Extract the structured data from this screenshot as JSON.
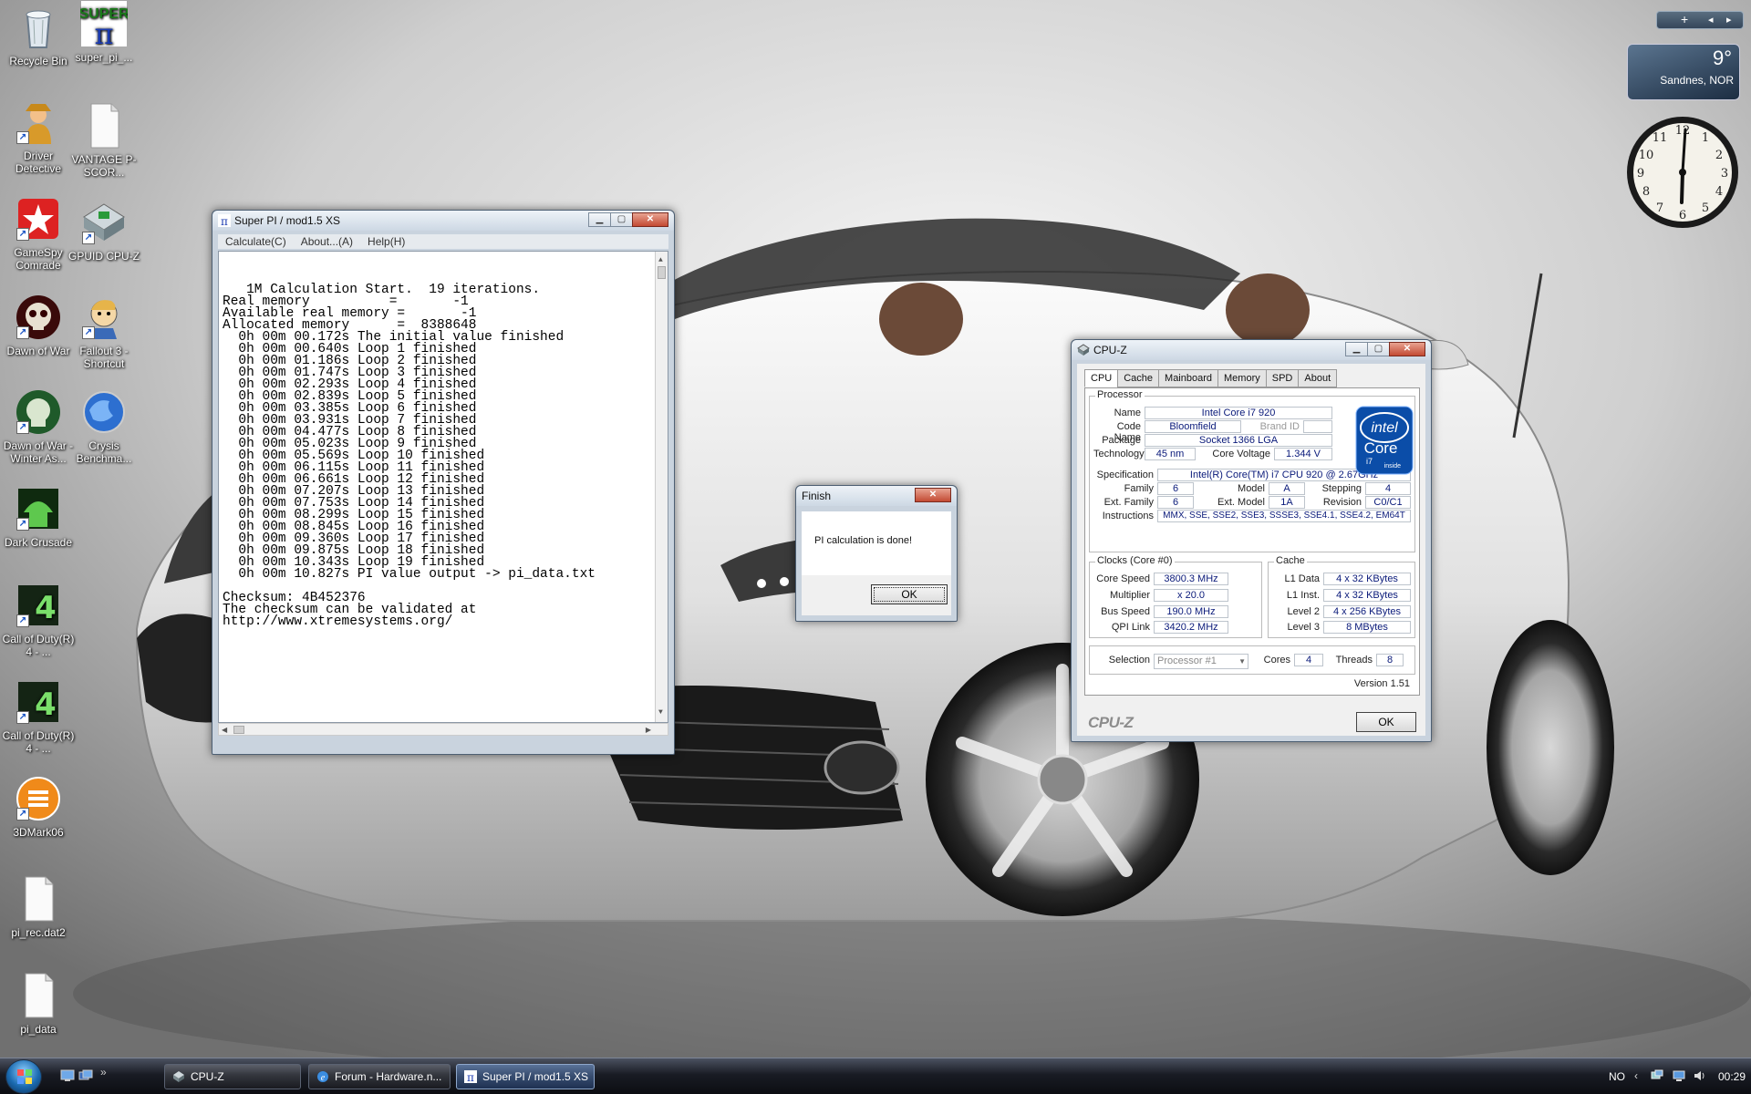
{
  "desktop": {
    "icons": [
      {
        "label": "Recycle Bin"
      },
      {
        "label": "super_pi_..."
      },
      {
        "label": "Driver Detective"
      },
      {
        "label": "VANTAGE P-SCOR..."
      },
      {
        "label": "GameSpy Comrade"
      },
      {
        "label": "GPUID CPU-Z"
      },
      {
        "label": "Dawn of War"
      },
      {
        "label": "Fallout 3 - Shortcut"
      },
      {
        "label": "Dawn of War - Winter As..."
      },
      {
        "label": "Crysis Benchma..."
      },
      {
        "label": "Dark Crusade"
      },
      {
        "label": "Call of Duty(R) 4 - ..."
      },
      {
        "label": "Call of Duty(R) 4 - ..."
      },
      {
        "label": "3DMark06"
      },
      {
        "label": "pi_rec.dat2"
      },
      {
        "label": "pi_data"
      }
    ]
  },
  "gadgets": {
    "weather": {
      "temp": "9°",
      "city": "Sandnes, NOR"
    },
    "toolbar": {
      "add": "+",
      "prev": "◂",
      "next": "▸"
    }
  },
  "superpi": {
    "title": "Super PI / mod1.5 XS",
    "menu": [
      "Calculate(C)",
      "About...(A)",
      "Help(H)"
    ],
    "output": [
      "   1M Calculation Start.  19 iterations.",
      "Real memory          =       -1",
      "Available real memory =       -1",
      "Allocated memory      =  8388648",
      "  0h 00m 00.172s The initial value finished",
      "  0h 00m 00.640s Loop 1 finished",
      "  0h 00m 01.186s Loop 2 finished",
      "  0h 00m 01.747s Loop 3 finished",
      "  0h 00m 02.293s Loop 4 finished",
      "  0h 00m 02.839s Loop 5 finished",
      "  0h 00m 03.385s Loop 6 finished",
      "  0h 00m 03.931s Loop 7 finished",
      "  0h 00m 04.477s Loop 8 finished",
      "  0h 00m 05.023s Loop 9 finished",
      "  0h 00m 05.569s Loop 10 finished",
      "  0h 00m 06.115s Loop 11 finished",
      "  0h 00m 06.661s Loop 12 finished",
      "  0h 00m 07.207s Loop 13 finished",
      "  0h 00m 07.753s Loop 14 finished",
      "  0h 00m 08.299s Loop 15 finished",
      "  0h 00m 08.845s Loop 16 finished",
      "  0h 00m 09.360s Loop 17 finished",
      "  0h 00m 09.875s Loop 18 finished",
      "  0h 00m 10.343s Loop 19 finished",
      "  0h 00m 10.827s PI value output -> pi_data.txt",
      "",
      "Checksum: 4B452376",
      "The checksum can be validated at",
      "http://www.xtremesystems.org/"
    ]
  },
  "finish": {
    "title": "Finish",
    "message": "PI calculation is done!",
    "ok": "OK"
  },
  "cpuz": {
    "title": "CPU-Z",
    "tabs": [
      "CPU",
      "Cache",
      "Mainboard",
      "Memory",
      "SPD",
      "About"
    ],
    "processor": {
      "legend": "Processor",
      "name_label": "Name",
      "name": "Intel Core i7 920",
      "codename_label": "Code Name",
      "codename": "Bloomfield",
      "brandid_label": "Brand ID",
      "brandid": "",
      "package_label": "Package",
      "package": "Socket 1366 LGA",
      "technology_label": "Technology",
      "technology": "45 nm",
      "voltage_label": "Core Voltage",
      "voltage": "1.344 V",
      "spec_label": "Specification",
      "spec": "Intel(R) Core(TM) i7 CPU       920  @ 2.67GHz",
      "family_label": "Family",
      "family": "6",
      "model_label": "Model",
      "model": "A",
      "stepping_label": "Stepping",
      "stepping": "4",
      "extfamily_label": "Ext. Family",
      "extfamily": "6",
      "extmodel_label": "Ext. Model",
      "extmodel": "1A",
      "revision_label": "Revision",
      "revision": "C0/C1",
      "instructions_label": "Instructions",
      "instructions": "MMX, SSE, SSE2, SSE3, SSSE3, SSE4.1, SSE4.2, EM64T"
    },
    "clocks": {
      "legend": "Clocks (Core #0)",
      "corespeed_label": "Core Speed",
      "corespeed": "3800.3 MHz",
      "multiplier_label": "Multiplier",
      "multiplier": "x 20.0",
      "busspeed_label": "Bus Speed",
      "busspeed": "190.0 MHz",
      "qpi_label": "QPI Link",
      "qpi": "3420.2 MHz"
    },
    "cache": {
      "legend": "Cache",
      "l1d_label": "L1 Data",
      "l1d": "4 x 32 KBytes",
      "l1i_label": "L1 Inst.",
      "l1i": "4 x 32 KBytes",
      "l2_label": "Level 2",
      "l2": "4 x 256 KBytes",
      "l3_label": "Level 3",
      "l3": "8 MBytes"
    },
    "selection_label": "Selection",
    "selection": "Processor #1",
    "cores_label": "Cores",
    "cores": "4",
    "threads_label": "Threads",
    "threads": "8",
    "version": "Version 1.51",
    "brand": "CPU-Z",
    "ok": "OK",
    "intel_logo": {
      "line1": "intel",
      "line2": "Core",
      "line3": "i7",
      "line4": "inside"
    }
  },
  "taskbar": {
    "tasks": [
      {
        "label": "CPU-Z",
        "active": false
      },
      {
        "label": "Forum - Hardware.n...",
        "active": false
      },
      {
        "label": "Super PI / mod1.5 XS",
        "active": true
      }
    ],
    "language": "NO",
    "time": "00:29"
  },
  "colors": {
    "cpuz_value_text": "#0a1a7a",
    "taskbar_dark": "#0c0d12",
    "close_button": "#c34a33"
  }
}
